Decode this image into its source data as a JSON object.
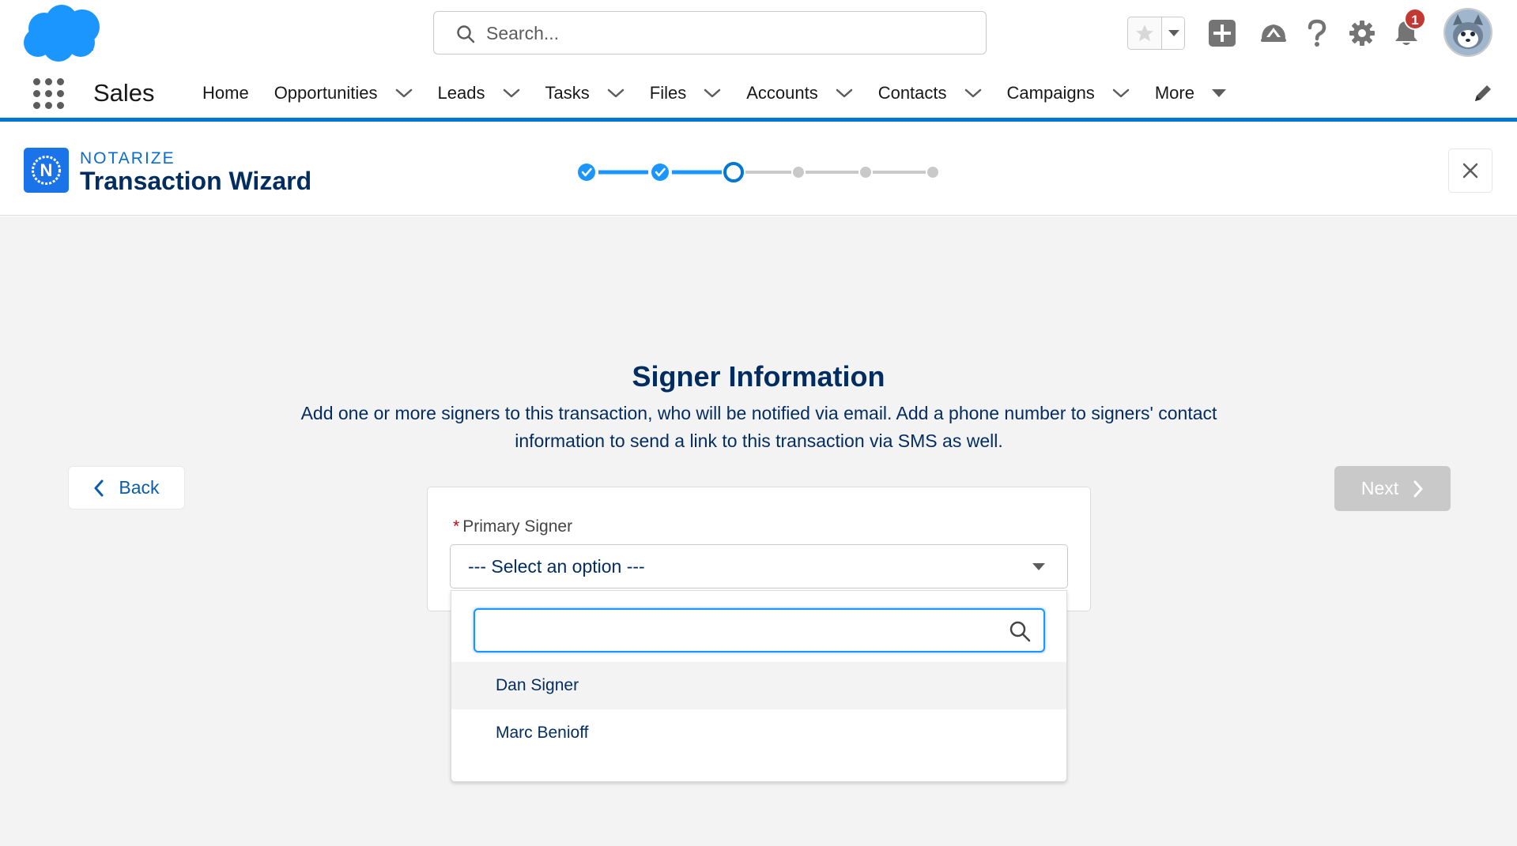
{
  "header": {
    "search_placeholder": "Search...",
    "notification_count": "1",
    "icons": [
      "salesforce-cloud-logo",
      "search-icon",
      "star-icon",
      "chevron-down-icon",
      "plus-icon",
      "trailhead-icon",
      "help-icon",
      "gear-icon",
      "bell-icon",
      "avatar"
    ]
  },
  "nav": {
    "app_name": "Sales",
    "items": [
      {
        "label": "Home",
        "dropdown": false
      },
      {
        "label": "Opportunities",
        "dropdown": true
      },
      {
        "label": "Leads",
        "dropdown": true
      },
      {
        "label": "Tasks",
        "dropdown": true
      },
      {
        "label": "Files",
        "dropdown": true
      },
      {
        "label": "Accounts",
        "dropdown": true
      },
      {
        "label": "Contacts",
        "dropdown": true
      },
      {
        "label": "Campaigns",
        "dropdown": true
      }
    ],
    "more_label": "More",
    "accent_color": "#0176d3"
  },
  "wizard": {
    "brand": "NOTARIZE",
    "title": "Transaction Wizard",
    "steps_total": 6,
    "steps_completed": 2,
    "current_step": 3,
    "logo_letter": "N"
  },
  "step": {
    "title": "Signer Information",
    "description": "Add one or more signers to this transaction, who will be notified via email. Add a phone number to signers' contact information to send a link to this transaction via SMS as well.",
    "back_label": "Back",
    "next_label": "Next",
    "next_enabled": false
  },
  "form": {
    "primary_signer_label": "Primary Signer",
    "required_marker": "*",
    "select_value": "--- Select an option ---",
    "search_value": "",
    "options": [
      "Dan Signer",
      "Marc Benioff"
    ],
    "highlighted_option": "Dan Signer"
  }
}
